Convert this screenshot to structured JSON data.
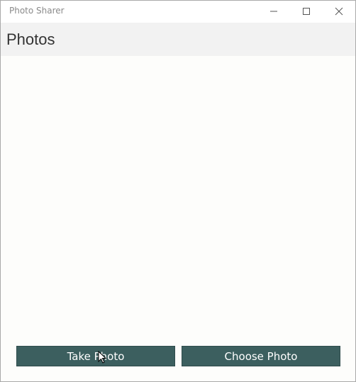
{
  "window": {
    "title": "Photo Sharer"
  },
  "header": {
    "title": "Photos"
  },
  "actions": {
    "take_photo_label": "Take Photo",
    "choose_photo_label": "Choose Photo"
  },
  "colors": {
    "button_background": "#3c5f5f",
    "button_text": "#ffffff",
    "header_background": "#f2f2f2",
    "content_background": "#fdfdfb"
  },
  "icons": {
    "minimize": "minimize-icon",
    "maximize": "maximize-icon",
    "close": "close-icon",
    "cursor": "mouse-pointer-icon"
  }
}
